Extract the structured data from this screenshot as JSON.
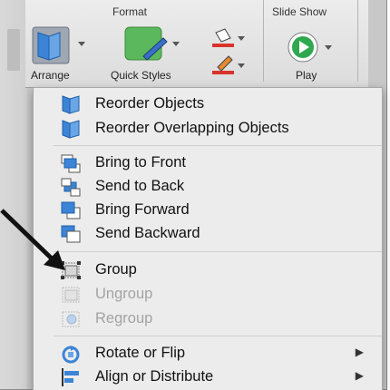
{
  "ribbon": {
    "format_title": "Format",
    "slideshow_title": "Slide Show",
    "arrange_label": "Arrange",
    "quick_styles_label": "Quick Styles",
    "play_label": "Play"
  },
  "menu": {
    "items": [
      {
        "label": "Reorder Objects",
        "icon": "reorder-objects-icon",
        "disabled": false
      },
      {
        "label": "Reorder Overlapping Objects",
        "icon": "reorder-overlapping-icon",
        "disabled": false
      },
      {
        "label": "Bring to Front",
        "icon": "bring-to-front-icon",
        "disabled": false
      },
      {
        "label": "Send to Back",
        "icon": "send-to-back-icon",
        "disabled": false
      },
      {
        "label": "Bring Forward",
        "icon": "bring-forward-icon",
        "disabled": false
      },
      {
        "label": "Send Backward",
        "icon": "send-backward-icon",
        "disabled": false
      },
      {
        "label": "Group",
        "icon": "group-icon",
        "disabled": false
      },
      {
        "label": "Ungroup",
        "icon": "ungroup-icon",
        "disabled": true
      },
      {
        "label": "Regroup",
        "icon": "regroup-icon",
        "disabled": true
      },
      {
        "label": "Rotate or Flip",
        "icon": "rotate-icon",
        "disabled": false,
        "submenu": true
      },
      {
        "label": "Align or Distribute",
        "icon": "align-icon",
        "disabled": false,
        "submenu": true
      }
    ],
    "submenu_glyph": "▶"
  },
  "colors": {
    "accent_blue": "#3b84d6",
    "quick_styles_green": "#5cb85c",
    "play_green": "#2fa84f",
    "menu_bg": "#ececec"
  }
}
